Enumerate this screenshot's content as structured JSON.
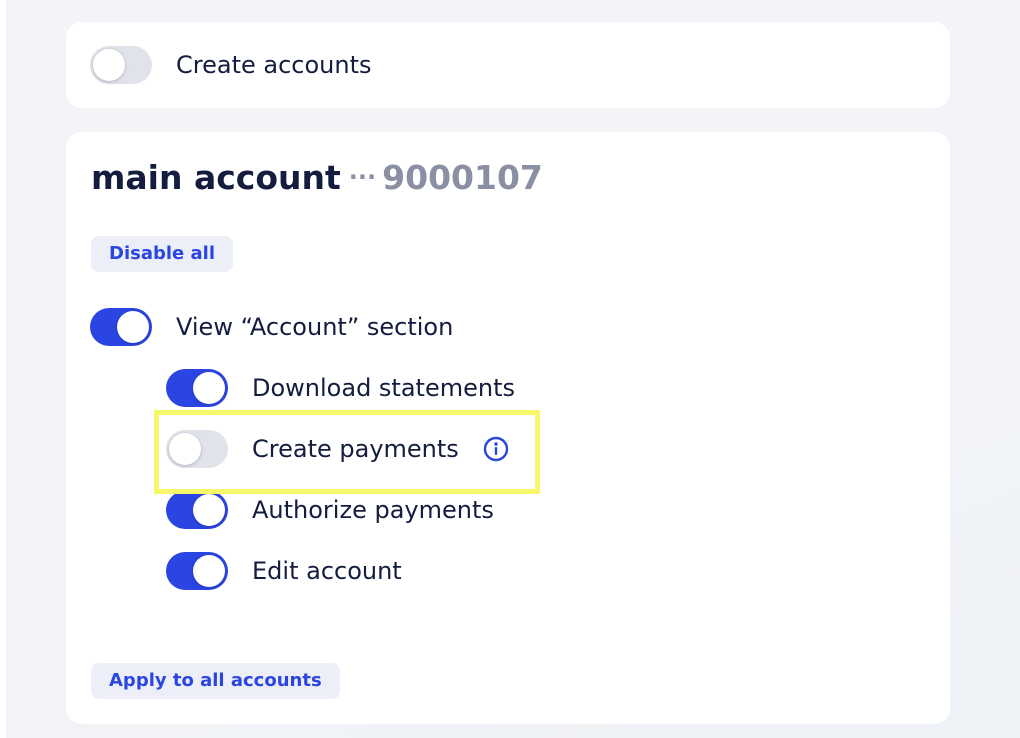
{
  "top_card": {
    "create_accounts_label": "Create accounts",
    "create_accounts_enabled": false
  },
  "account": {
    "name": "main account",
    "separator": "···",
    "number": "9000107",
    "disable_all_label": "Disable all",
    "permissions": [
      {
        "label": "View “Account” section",
        "enabled": true
      },
      {
        "label": "Download statements",
        "enabled": true
      },
      {
        "label": "Create payments",
        "enabled": false,
        "has_info": true,
        "highlighted": true
      },
      {
        "label": "Authorize payments",
        "enabled": true
      },
      {
        "label": "Edit account",
        "enabled": true
      }
    ],
    "apply_all_label": "Apply to all accounts"
  },
  "colors": {
    "accent": "#2b45e3",
    "toggle_off": "#e1e3ea",
    "highlight": "#f7f76a",
    "text": "#141c3f",
    "muted": "#8a8fa3"
  },
  "icons": {
    "info": "info-circle-icon"
  }
}
